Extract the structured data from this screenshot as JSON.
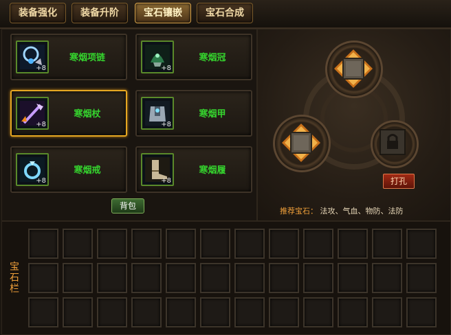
{
  "tabs": [
    {
      "label": "装备强化",
      "active": false
    },
    {
      "label": "装备升阶",
      "active": false
    },
    {
      "label": "宝石镶嵌",
      "active": true
    },
    {
      "label": "宝石合成",
      "active": false
    }
  ],
  "equipment": [
    {
      "name": "寒烟项链",
      "level": "+8",
      "icon": "necklace-icon",
      "selected": false
    },
    {
      "name": "寒烟冠",
      "level": "+8",
      "icon": "helmet-icon",
      "selected": false
    },
    {
      "name": "寒烟杖",
      "level": "+8",
      "icon": "staff-icon",
      "selected": true
    },
    {
      "name": "寒烟甲",
      "level": "+8",
      "icon": "armor-icon",
      "selected": false
    },
    {
      "name": "寒烟戒",
      "level": "+8",
      "icon": "ring-icon",
      "selected": false
    },
    {
      "name": "寒烟履",
      "level": "+8",
      "icon": "boots-icon",
      "selected": false
    }
  ],
  "bag_button": "背包",
  "socket": {
    "punch_button": "打孔",
    "recommend_label": "推荐宝石：",
    "recommend_value": "法攻、气血、物防、法防"
  },
  "gem_bar": {
    "label": "宝石栏"
  },
  "colors": {
    "equip_name": "#35d42e",
    "selected_border": "#e6a722",
    "accent": "#f0a03a"
  }
}
